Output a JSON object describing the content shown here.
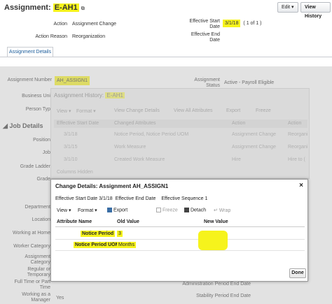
{
  "header": {
    "title_prefix": "Assignment:",
    "title_value": "E-AH1",
    "edit_label": "Edit",
    "edit_caret": "▾",
    "history_label": "View History"
  },
  "summary": {
    "action_label": "Action",
    "action_value": "Assignment Change",
    "reason_label": "Action Reason",
    "reason_value": "Reorganization",
    "start_label": "Effective Start Date",
    "start_value": "3/1/18",
    "start_range": "( 1 of 1 )",
    "end_label": "Effective End Date"
  },
  "tab": {
    "label": "Assignment Details"
  },
  "details": {
    "assignment_number_label": "Assignment Number",
    "assignment_number_value": "AH_ASSIGN1",
    "status_label": "Assignment Status",
    "status_value": "Active - Payroll Eligible",
    "business_unit_label": "Business Uni",
    "person_type_label": "Person Typ",
    "job_details_heading": "Job Details",
    "side_labels": [
      "Position",
      "Job",
      "Grade Ladder",
      "Grade",
      "Department",
      "Location",
      "Working at Home",
      "Worker Category",
      "Assignment Category",
      "Regular or Temporary",
      "Full Time or Part Time",
      "Working as a Manager"
    ],
    "working_manager_value": "Yes",
    "admin_end_label": "Administration Period End Date",
    "stability_end_label": "Stability Period End Date"
  },
  "history_dialog": {
    "title": "Assignment History:",
    "title_value": "E-AH1",
    "toolbar": [
      "View ▾",
      "Format ▾",
      "View Change Details",
      "View All Attributes",
      "Export",
      "Freeze"
    ],
    "columns": [
      "Effective Start Date",
      "Changed Attributes",
      "Action",
      "Action"
    ],
    "rows": [
      [
        "3/1/18",
        "Notice Period, Notice Period UOM",
        "Assignment Change",
        "Reorgani"
      ],
      [
        "3/1/15",
        "Work Measure",
        "Assignment Change",
        "Reorgani"
      ],
      [
        "3/1/10",
        "Created  Work Measure",
        "Hire",
        "Hire to ("
      ]
    ],
    "columns_hidden": "Columns Hidden"
  },
  "change_dialog": {
    "title": "Change Details: Assignment AH_ASSIGN1",
    "close": "×",
    "info": {
      "start_label": "Effective Start Date",
      "start_value": "3/1/18",
      "end_label": "Effective End Date",
      "seq_label": "Effective Sequence",
      "seq_value": "1"
    },
    "toolbar": {
      "view": "View ▾",
      "format": "Format ▾",
      "export": "Export",
      "freeze": "Freeze",
      "detach": "Detach",
      "wrap": "Wrap"
    },
    "columns": [
      "Attribute Name",
      "Old Value",
      "New Value"
    ],
    "rows": [
      {
        "name": "Notice Period",
        "old": "3",
        "new": ""
      },
      {
        "name": "Notice Period UOM",
        "old": "Months",
        "new": ""
      }
    ],
    "done_label": "Done"
  },
  "colors": {
    "highlight": "#f6f31c",
    "link": "#1a5b9a"
  }
}
